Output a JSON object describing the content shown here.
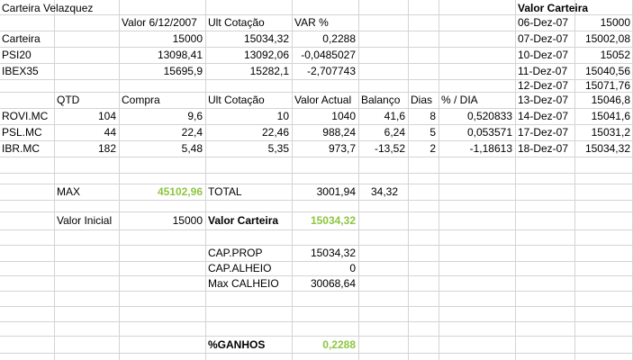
{
  "title": "Carteira Velazquez",
  "header_row": {
    "valor_date": "Valor 6/12/2007",
    "ult_cotacao": "Ult Cotação",
    "var_pct": "VAR %"
  },
  "index_rows": [
    {
      "name": "Carteira",
      "valor": "15000",
      "ult": "15034,32",
      "var": "0,2288"
    },
    {
      "name": "PSI20",
      "valor": "13098,41",
      "ult": "13092,06",
      "var": "-0,0485027"
    },
    {
      "name": "IBEX35",
      "valor": "15695,9",
      "ult": "15282,1",
      "var": "-2,707743"
    }
  ],
  "positions_header": {
    "qtd": "QTD",
    "compra": "Compra",
    "ult_cotacao": "Ult Cotação",
    "valor_actual": "Valor Actual",
    "balanco": "Balanço",
    "dias": "Dias",
    "pct_dia": "% / DIA"
  },
  "positions": [
    {
      "ticker": "ROVI.MC",
      "qtd": "104",
      "compra": "9,6",
      "ult": "10",
      "valor_actual": "1040",
      "balanco": "41,6",
      "dias": "8",
      "pct_dia": "0,520833"
    },
    {
      "ticker": "PSL.MC",
      "qtd": "44",
      "compra": "22,4",
      "ult": "22,46",
      "valor_actual": "988,24",
      "balanco": "6,24",
      "dias": "5",
      "pct_dia": "0,053571"
    },
    {
      "ticker": "IBR.MC",
      "qtd": "182",
      "compra": "5,48",
      "ult": "5,35",
      "valor_actual": "973,7",
      "balanco": "-13,52",
      "dias": "2",
      "pct_dia": "-1,18613"
    }
  ],
  "summary": {
    "max_label": "MAX",
    "max_value": "45102,96",
    "total_label": "TOTAL",
    "total_value": "3001,94",
    "total_balanco": "34,32",
    "valor_inicial_label": "Valor Inicial",
    "valor_inicial_value": "15000",
    "valor_carteira_label": "Valor Carteira",
    "valor_carteira_value": "15034,32",
    "cap_prop_label": "CAP.PROP",
    "cap_prop_value": "15034,32",
    "cap_alheio_label": "CAP.ALHEIO",
    "cap_alheio_value": "0",
    "max_calheio_label": "Max CALHEIO",
    "max_calheio_value": "30068,64",
    "ganhos_label": "%GANHOS",
    "ganhos_value": "0,2288"
  },
  "history": {
    "title": "Valor Carteira",
    "rows": [
      {
        "date": "06-Dez-07",
        "value": "15000"
      },
      {
        "date": "07-Dez-07",
        "value": "15002,08"
      },
      {
        "date": "10-Dez-07",
        "value": "15052"
      },
      {
        "date": "11-Dez-07",
        "value": "15040,56"
      },
      {
        "date": "12-Dez-07",
        "value": "15071,76"
      },
      {
        "date": "13-Dez-07",
        "value": "15046,8"
      },
      {
        "date": "14-Dez-07",
        "value": "15041,6"
      },
      {
        "date": "17-Dez-07",
        "value": "15031,2"
      },
      {
        "date": "18-Dez-07",
        "value": "15034,32"
      }
    ]
  },
  "colors": {
    "gridline": "#d4d4d4",
    "highlight_green": "#8dc63f",
    "text": "#000000"
  }
}
